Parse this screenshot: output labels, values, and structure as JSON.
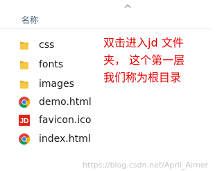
{
  "explorer": {
    "column_header": "名称",
    "files": [
      {
        "name": "css",
        "icon": "folder-icon"
      },
      {
        "name": "fonts",
        "icon": "folder-icon"
      },
      {
        "name": "images",
        "icon": "folder-icon"
      },
      {
        "name": "demo.html",
        "icon": "chrome-icon"
      },
      {
        "name": "favicon.ico",
        "icon": "jd-logo-icon"
      },
      {
        "name": "index.html",
        "icon": "chrome-icon"
      }
    ]
  },
  "annotation": {
    "lines": [
      "双击进入jd 文件",
      "夹， 这个第一层",
      "我们称为根目录"
    ],
    "color": "#e60000"
  },
  "watermark": "https://blog.csdn.net/April_Aimer",
  "colors": {
    "folder": "#f4c542",
    "jd_red": "#e1251b"
  }
}
